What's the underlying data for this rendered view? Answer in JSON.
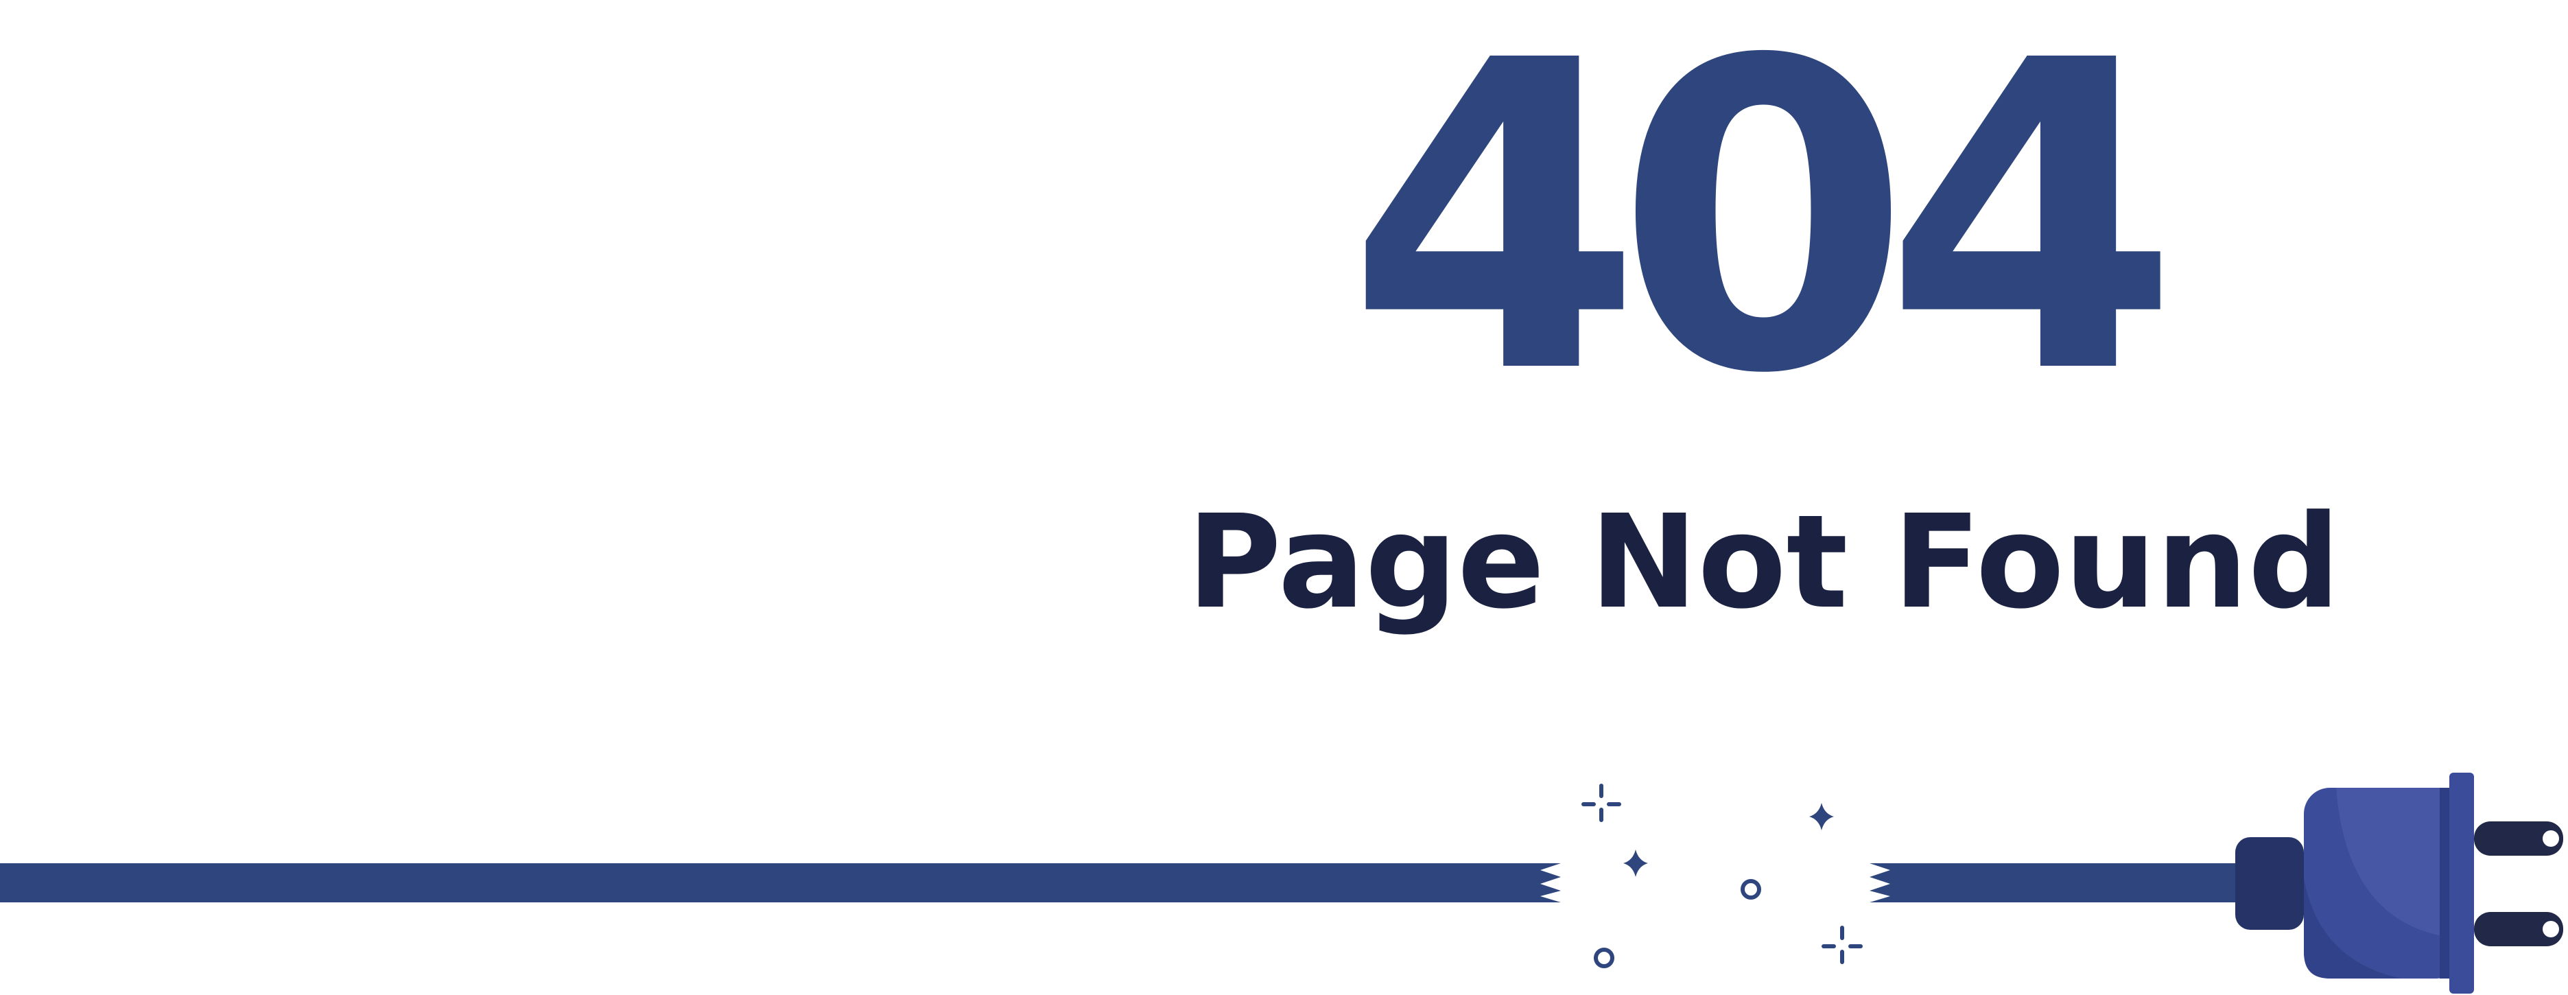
{
  "error": {
    "code": "404",
    "message": "Page Not Found"
  },
  "illustration": {
    "subject": "unplugged-power-cable",
    "cable_color": "#2e467d",
    "plug_body_color": "#3b4d9a",
    "plug_highlight_color": "#4856a6",
    "plug_dark_color": "#263366",
    "prong_color": "#222847"
  },
  "colors": {
    "heading": "#2e467d",
    "subtitle": "#1b2140",
    "background": "#ffffff"
  }
}
